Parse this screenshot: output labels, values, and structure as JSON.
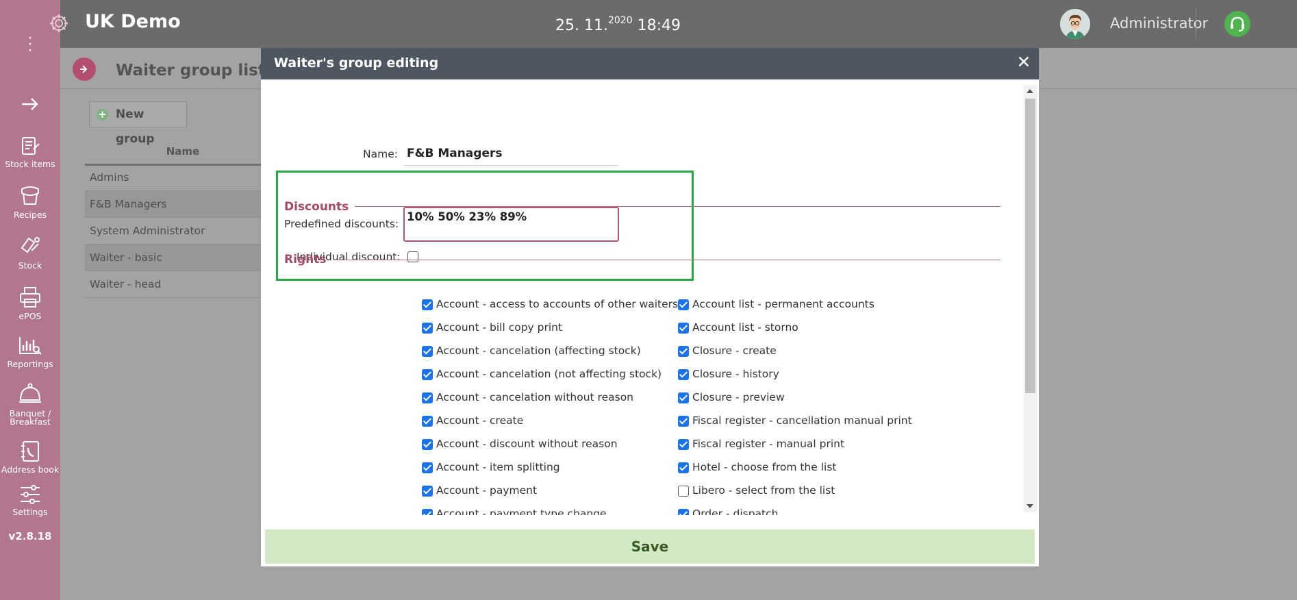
{
  "app": {
    "title": "UK Demo",
    "version": "v2.8.18"
  },
  "topbar": {
    "date": "25. 11.",
    "year": "2020",
    "time": "18:49",
    "user": "Administrator"
  },
  "sidebar": {
    "items": [
      {
        "label": "Stock items",
        "icon": "stock-items-icon"
      },
      {
        "label": "Recipes",
        "icon": "recipes-icon"
      },
      {
        "label": "Stock",
        "icon": "stock-icon"
      },
      {
        "label": "ePOS",
        "icon": "printer-icon"
      },
      {
        "label": "Reportings",
        "icon": "chart-icon"
      },
      {
        "label": "Banquet / Breakfast",
        "icon": "cloche-icon"
      },
      {
        "label": "Address book",
        "icon": "address-book-icon"
      },
      {
        "label": "Settings",
        "icon": "sliders-icon"
      }
    ]
  },
  "page": {
    "title": "Waiter group list",
    "new_group": "New group",
    "column_name": "Name",
    "rows": [
      "Admins",
      "F&B Managers",
      "System Administrator",
      "Waiter - basic",
      "Waiter - head"
    ]
  },
  "modal": {
    "title": "Waiter's group editing",
    "name_label": "Name:",
    "name_value": "F&B Managers",
    "discounts_title": "Discounts",
    "predefined_label": "Predefined discounts:",
    "predefined_value": "10% 50% 23% 89%",
    "individual_label": "Individual discount:",
    "individual_checked": false,
    "rights_title": "Rights",
    "rights_left": [
      {
        "label": "Account - access to accounts of other waiters",
        "checked": true
      },
      {
        "label": "Account - bill copy print",
        "checked": true
      },
      {
        "label": "Account - cancelation (affecting stock)",
        "checked": true
      },
      {
        "label": "Account - cancelation (not affecting stock)",
        "checked": true
      },
      {
        "label": "Account - cancelation without reason",
        "checked": true
      },
      {
        "label": "Account - create",
        "checked": true
      },
      {
        "label": "Account - discount without reason",
        "checked": true
      },
      {
        "label": "Account - item splitting",
        "checked": true
      },
      {
        "label": "Account - payment",
        "checked": true
      },
      {
        "label": "Account - payment type change",
        "checked": true
      }
    ],
    "rights_right": [
      {
        "label": "Account list - permanent accounts",
        "checked": true
      },
      {
        "label": "Account list - storno",
        "checked": true
      },
      {
        "label": "Closure - create",
        "checked": true
      },
      {
        "label": "Closure - history",
        "checked": true
      },
      {
        "label": "Closure - preview",
        "checked": true
      },
      {
        "label": "Fiscal register - cancellation manual print",
        "checked": true
      },
      {
        "label": "Fiscal register - manual print",
        "checked": true
      },
      {
        "label": "Hotel - choose from the list",
        "checked": true
      },
      {
        "label": "Libero - select from the list",
        "checked": false
      },
      {
        "label": "Order - dispatch",
        "checked": true
      }
    ],
    "save_label": "Save"
  },
  "colors": {
    "sidebar": "#b2778f",
    "topbar": "#6b6b6b",
    "modal_header": "#4e5761",
    "accent": "#a44a66",
    "highlight": "#28a745",
    "save_bg": "#d3e8c5"
  }
}
